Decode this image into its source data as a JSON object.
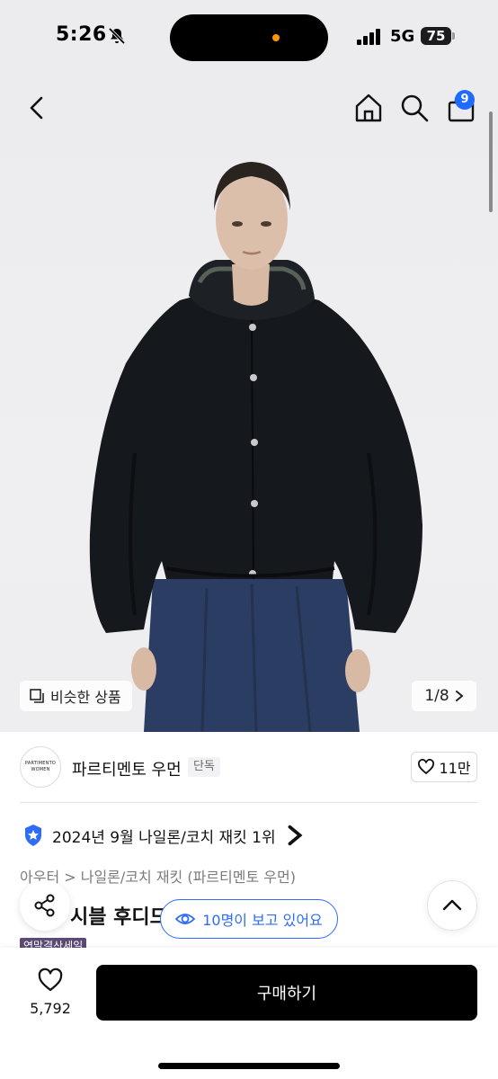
{
  "status_bar": {
    "time": "5:26",
    "network": "5G",
    "battery": "75"
  },
  "header": {
    "cart_count": "9"
  },
  "hero": {
    "similar_label": "비슷한 상품",
    "page_indicator": "1/8"
  },
  "brand": {
    "logo_line1": "PARTIMENTO",
    "logo_line2": "WOMEN",
    "name": "파르티멘토 우먼",
    "tag": "단독",
    "likes": "11만"
  },
  "ranking": {
    "text": "2024년 9월 나일론/코치 재킷 1위"
  },
  "breadcrumb": {
    "text": "아우터 > 나일론/코치 재킷 (파르티멘토 우먼)"
  },
  "product": {
    "title_visible": "시블 후디드",
    "sale_tag": "연말결산세일"
  },
  "viewers": {
    "text": "10명이 보고 있어요"
  },
  "bottom": {
    "wish_count": "5,792",
    "buy_label": "구매하기"
  },
  "colors": {
    "accent_blue": "#2f6cf6",
    "badge_blue": "#1f6bff",
    "buy_bg": "#000000",
    "sale_tag_bg": "#5b4a75"
  },
  "icons": [
    "back-icon",
    "home-icon",
    "search-icon",
    "bag-icon",
    "copy-icon",
    "chevron-right-icon",
    "heart-icon",
    "star-badge-icon",
    "share-icon",
    "chevron-up-icon",
    "eye-icon"
  ]
}
